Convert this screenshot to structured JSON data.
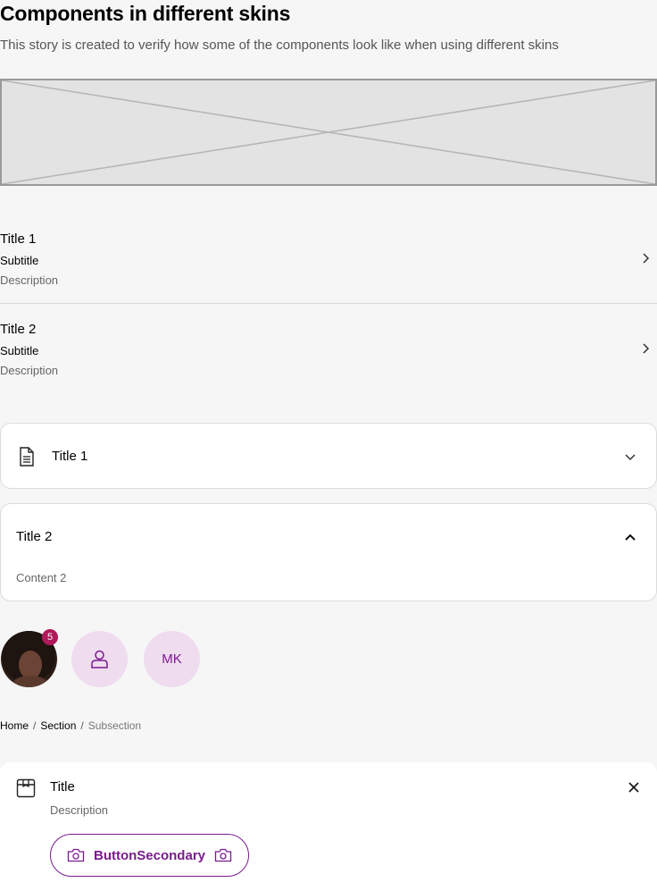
{
  "header": {
    "title": "Components in different skins",
    "description": "This story is created to verify how some of the components look like when using different skins"
  },
  "list_rows": [
    {
      "title": "Title 1",
      "subtitle": "Subtitle",
      "description": "Description",
      "icon": "chevron-right-icon"
    },
    {
      "title": "Title 2",
      "subtitle": "Subtitle",
      "description": "Description",
      "icon": "chevron-right-icon"
    }
  ],
  "accordions": [
    {
      "title": "Title 1",
      "icon": "document-icon",
      "expanded": false,
      "toggle_icon": "chevron-down-icon"
    },
    {
      "title": "Title 2",
      "expanded": true,
      "content": "Content 2",
      "toggle_icon": "chevron-up-icon"
    }
  ],
  "avatars": {
    "photo_badge": "5",
    "icon": "user-icon",
    "initials": "MK",
    "accent_bg": "#efdcef",
    "badge_color": "#b0195a"
  },
  "breadcrumb": {
    "items": [
      "Home",
      "Section"
    ],
    "current": "Subsection",
    "separator": "/"
  },
  "callout": {
    "icon": "box-icon",
    "title": "Title",
    "description": "Description",
    "close_icon": "close-icon",
    "button_label": "ButtonSecondary",
    "button_icon": "camera-icon",
    "accent": "#7a1a8f"
  }
}
